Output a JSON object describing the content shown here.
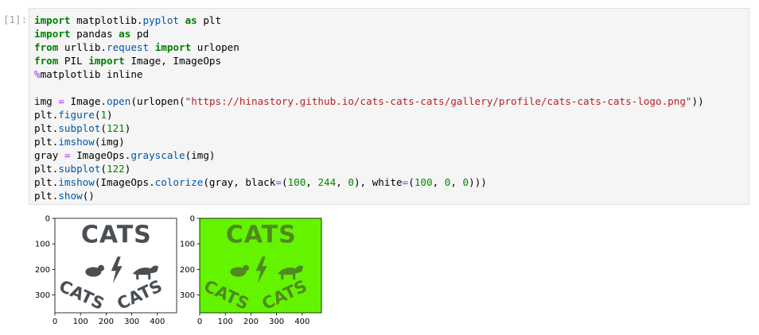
{
  "cell": {
    "prompt": "[1]:",
    "code_lines": [
      [
        {
          "t": "kw",
          "v": "import"
        },
        {
          "t": "txt",
          "v": " matplotlib."
        },
        {
          "t": "fn",
          "v": "pyplot"
        },
        {
          "t": "txt",
          "v": " "
        },
        {
          "t": "kw",
          "v": "as"
        },
        {
          "t": "txt",
          "v": " plt"
        }
      ],
      [
        {
          "t": "kw",
          "v": "import"
        },
        {
          "t": "txt",
          "v": " pandas "
        },
        {
          "t": "kw",
          "v": "as"
        },
        {
          "t": "txt",
          "v": " pd"
        }
      ],
      [
        {
          "t": "kw",
          "v": "from"
        },
        {
          "t": "txt",
          "v": " urllib."
        },
        {
          "t": "fn",
          "v": "request"
        },
        {
          "t": "txt",
          "v": " "
        },
        {
          "t": "kw",
          "v": "import"
        },
        {
          "t": "txt",
          "v": " urlopen"
        }
      ],
      [
        {
          "t": "kw",
          "v": "from"
        },
        {
          "t": "txt",
          "v": " PIL "
        },
        {
          "t": "kw",
          "v": "import"
        },
        {
          "t": "txt",
          "v": " Image, ImageOps"
        }
      ],
      [
        {
          "t": "op",
          "v": "%"
        },
        {
          "t": "txt",
          "v": "matplotlib inline"
        }
      ],
      [],
      [
        {
          "t": "txt",
          "v": "img "
        },
        {
          "t": "op",
          "v": "="
        },
        {
          "t": "txt",
          "v": " Image."
        },
        {
          "t": "fn",
          "v": "open"
        },
        {
          "t": "txt",
          "v": "(urlopen("
        },
        {
          "t": "str",
          "v": "\"https://hinastory.github.io/cats-cats-cats/gallery/profile/cats-cats-cats-logo.png\""
        },
        {
          "t": "txt",
          "v": "))"
        }
      ],
      [
        {
          "t": "txt",
          "v": "plt."
        },
        {
          "t": "fn",
          "v": "figure"
        },
        {
          "t": "txt",
          "v": "("
        },
        {
          "t": "num",
          "v": "1"
        },
        {
          "t": "txt",
          "v": ")"
        }
      ],
      [
        {
          "t": "txt",
          "v": "plt."
        },
        {
          "t": "fn",
          "v": "subplot"
        },
        {
          "t": "txt",
          "v": "("
        },
        {
          "t": "num",
          "v": "121"
        },
        {
          "t": "txt",
          "v": ")"
        }
      ],
      [
        {
          "t": "txt",
          "v": "plt."
        },
        {
          "t": "fn",
          "v": "imshow"
        },
        {
          "t": "txt",
          "v": "(img)"
        }
      ],
      [
        {
          "t": "txt",
          "v": "gray "
        },
        {
          "t": "op",
          "v": "="
        },
        {
          "t": "txt",
          "v": " ImageOps."
        },
        {
          "t": "fn",
          "v": "grayscale"
        },
        {
          "t": "txt",
          "v": "(img)"
        }
      ],
      [
        {
          "t": "txt",
          "v": "plt."
        },
        {
          "t": "fn",
          "v": "subplot"
        },
        {
          "t": "txt",
          "v": "("
        },
        {
          "t": "num",
          "v": "122"
        },
        {
          "t": "txt",
          "v": ")"
        }
      ],
      [
        {
          "t": "txt",
          "v": "plt."
        },
        {
          "t": "fn",
          "v": "imshow"
        },
        {
          "t": "txt",
          "v": "(ImageOps."
        },
        {
          "t": "fn",
          "v": "colorize"
        },
        {
          "t": "txt",
          "v": "(gray, black"
        },
        {
          "t": "op",
          "v": "="
        },
        {
          "t": "txt",
          "v": "("
        },
        {
          "t": "num",
          "v": "100"
        },
        {
          "t": "txt",
          "v": ", "
        },
        {
          "t": "num",
          "v": "244"
        },
        {
          "t": "txt",
          "v": ", "
        },
        {
          "t": "num",
          "v": "0"
        },
        {
          "t": "txt",
          "v": "), white"
        },
        {
          "t": "op",
          "v": "="
        },
        {
          "t": "txt",
          "v": "("
        },
        {
          "t": "num",
          "v": "100"
        },
        {
          "t": "txt",
          "v": ", "
        },
        {
          "t": "num",
          "v": "0"
        },
        {
          "t": "txt",
          "v": ", "
        },
        {
          "t": "num",
          "v": "0"
        },
        {
          "t": "txt",
          "v": ")))"
        }
      ],
      [
        {
          "t": "txt",
          "v": "plt."
        },
        {
          "t": "fn",
          "v": "show"
        },
        {
          "t": "txt",
          "v": "()"
        }
      ]
    ]
  },
  "output": {
    "panels": [
      {
        "name": "original",
        "background": "#ffffff",
        "ink": "#4a4f54",
        "x_ticks": [
          "0",
          "100",
          "200",
          "300",
          "400"
        ],
        "y_ticks": [
          "0",
          "100",
          "200",
          "300"
        ],
        "logo_word": "CATS",
        "arc_words": [
          "CATS",
          "CATS"
        ]
      },
      {
        "name": "colorized",
        "background": "#64f400",
        "ink": "#4f8a20",
        "x_ticks": [
          "0",
          "100",
          "200",
          "300",
          "400"
        ],
        "y_ticks": [
          "0",
          "100",
          "200",
          "300"
        ],
        "logo_word": "CATS",
        "arc_words": [
          "CATS",
          "CATS"
        ]
      }
    ]
  }
}
